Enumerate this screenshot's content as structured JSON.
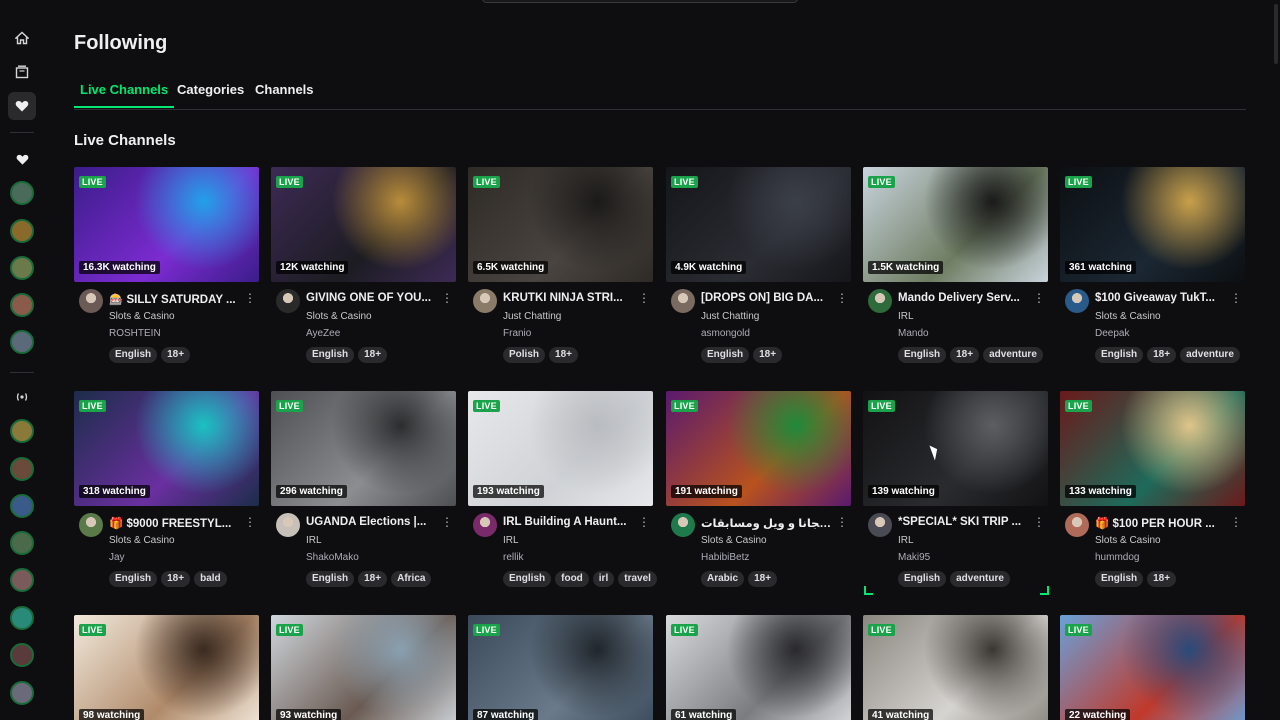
{
  "page": {
    "title": "Following",
    "section_title": "Live Channels"
  },
  "tabs": [
    {
      "label": "Live Channels",
      "active": true
    },
    {
      "label": "Categories",
      "active": false
    },
    {
      "label": "Channels",
      "active": false
    }
  ],
  "rail": {
    "icons": [
      "home-icon",
      "browse-icon",
      "following-heart-icon",
      "heart-icon",
      "live-broadcast-icon"
    ],
    "accent": "#00e872"
  },
  "cards": [
    {
      "live": "LIVE",
      "viewers": "16.3K watching",
      "title": "🎰 SILLY SATURDAY ...",
      "category": "Slots & Casino",
      "streamer": "ROSHTEIN",
      "tags": [
        "English",
        "18+"
      ],
      "thumb": [
        "#3b1d8a",
        "#7c2bd1",
        "#22a0e8"
      ],
      "avatar": "#6b5a55"
    },
    {
      "live": "LIVE",
      "viewers": "12K watching",
      "title": "GIVING ONE OF YOU...",
      "category": "Slots & Casino",
      "streamer": "AyeZee",
      "tags": [
        "English",
        "18+"
      ],
      "thumb": [
        "#3d2a55",
        "#1c1c22",
        "#b88c3a"
      ],
      "avatar": "#2a2a2a"
    },
    {
      "live": "LIVE",
      "viewers": "6.5K watching",
      "title": "KRUTKI NINJA STRI...",
      "category": "Just Chatting",
      "streamer": "Franio",
      "tags": [
        "Polish",
        "18+"
      ],
      "thumb": [
        "#2e2a26",
        "#4a4440",
        "#1b1a18"
      ],
      "avatar": "#8a7a68"
    },
    {
      "live": "LIVE",
      "viewers": "4.9K watching",
      "title": "[DROPS ON] BIG DA...",
      "category": "Just Chatting",
      "streamer": "asmongold",
      "tags": [
        "English",
        "18+"
      ],
      "thumb": [
        "#15161a",
        "#2a2c33",
        "#3b3f48"
      ],
      "avatar": "#7a6a60"
    },
    {
      "live": "LIVE",
      "viewers": "1.5K watching",
      "title": "Mando Delivery Serv...",
      "category": "IRL",
      "streamer": "Mando",
      "tags": [
        "English",
        "18+",
        "adventure"
      ],
      "thumb": [
        "#c9d3dd",
        "#6e7d62",
        "#1a1a1a"
      ],
      "avatar": "#2e6b3a"
    },
    {
      "live": "LIVE",
      "viewers": "361 watching",
      "title": "$100 Giveaway TukT...",
      "category": "Slots & Casino",
      "streamer": "Deepak",
      "tags": [
        "English",
        "18+",
        "adventure"
      ],
      "thumb": [
        "#0c0f12",
        "#1b2733",
        "#c9a04a"
      ],
      "avatar": "#2a5a8a"
    },
    {
      "live": "LIVE",
      "viewers": "318 watching",
      "title": "🎁 $9000 FREESTYL...",
      "category": "Slots & Casino",
      "streamer": "Jay",
      "tags": [
        "English",
        "18+",
        "bald"
      ],
      "thumb": [
        "#1c2d4a",
        "#6a2fa0",
        "#19c2c2"
      ],
      "avatar": "#5a7a4a"
    },
    {
      "live": "LIVE",
      "viewers": "296 watching",
      "title": "UGANDA Elections |...",
      "category": "IRL",
      "streamer": "ShakoMako",
      "tags": [
        "English",
        "18+",
        "Africa"
      ],
      "thumb": [
        "#4d4f52",
        "#8b8d90",
        "#2c2d2f"
      ],
      "avatar": "#c7c0b8"
    },
    {
      "live": "LIVE",
      "viewers": "193 watching",
      "title": "IRL Building A Haunt...",
      "category": "IRL",
      "streamer": "rellik",
      "tags": [
        "English",
        "food",
        "irl",
        "travel"
      ],
      "thumb": [
        "#e7e8ea",
        "#cfd2d6",
        "#b9bcc0"
      ],
      "avatar": "#7a2a6a"
    },
    {
      "live": "LIVE",
      "viewers": "191 watching",
      "title": "سولت مجانا و ويل ومسابقات ...",
      "category": "Slots & Casino",
      "streamer": "HabibiBetz",
      "tags": [
        "Arabic",
        "18+"
      ],
      "thumb": [
        "#5a1a6e",
        "#b8521e",
        "#1e8a3a"
      ],
      "avatar": "#1e7a4a"
    },
    {
      "live": "LIVE",
      "viewers": "139 watching",
      "title": "*SPECIAL* SKI TRIP ...",
      "category": "IRL",
      "streamer": "Maki95",
      "tags": [
        "English",
        "adventure"
      ],
      "thumb": [
        "#121214",
        "#2a2b2e",
        "#5c5e62"
      ],
      "avatar": "#4a4a55"
    },
    {
      "live": "LIVE",
      "viewers": "133 watching",
      "title": "🎁 $100 PER HOUR ...",
      "category": "Slots & Casino",
      "streamer": "hummdog",
      "tags": [
        "English",
        "18+"
      ],
      "thumb": [
        "#6a1a1a",
        "#1e6a5a",
        "#e0c48a"
      ],
      "avatar": "#b06a5a"
    },
    {
      "live": "LIVE",
      "viewers": "98 watching",
      "thumb": [
        "#f2e9dc",
        "#b08a6a",
        "#3a2a20"
      ]
    },
    {
      "live": "LIVE",
      "viewers": "93 watching",
      "thumb": [
        "#cfd6dc",
        "#6a5a52",
        "#8aa0b0"
      ]
    },
    {
      "live": "LIVE",
      "viewers": "87 watching",
      "thumb": [
        "#3a4a5a",
        "#6a7a8a",
        "#20262c"
      ]
    },
    {
      "live": "LIVE",
      "viewers": "61 watching",
      "thumb": [
        "#d8dadc",
        "#7a7c80",
        "#2a2a2e"
      ]
    },
    {
      "live": "LIVE",
      "viewers": "41 watching",
      "thumb": [
        "#8a8680",
        "#d6d4d0",
        "#3a3632"
      ]
    },
    {
      "live": "LIVE",
      "viewers": "22 watching",
      "thumb": [
        "#6aa0d8",
        "#c0392b",
        "#2a4a7a"
      ]
    }
  ]
}
